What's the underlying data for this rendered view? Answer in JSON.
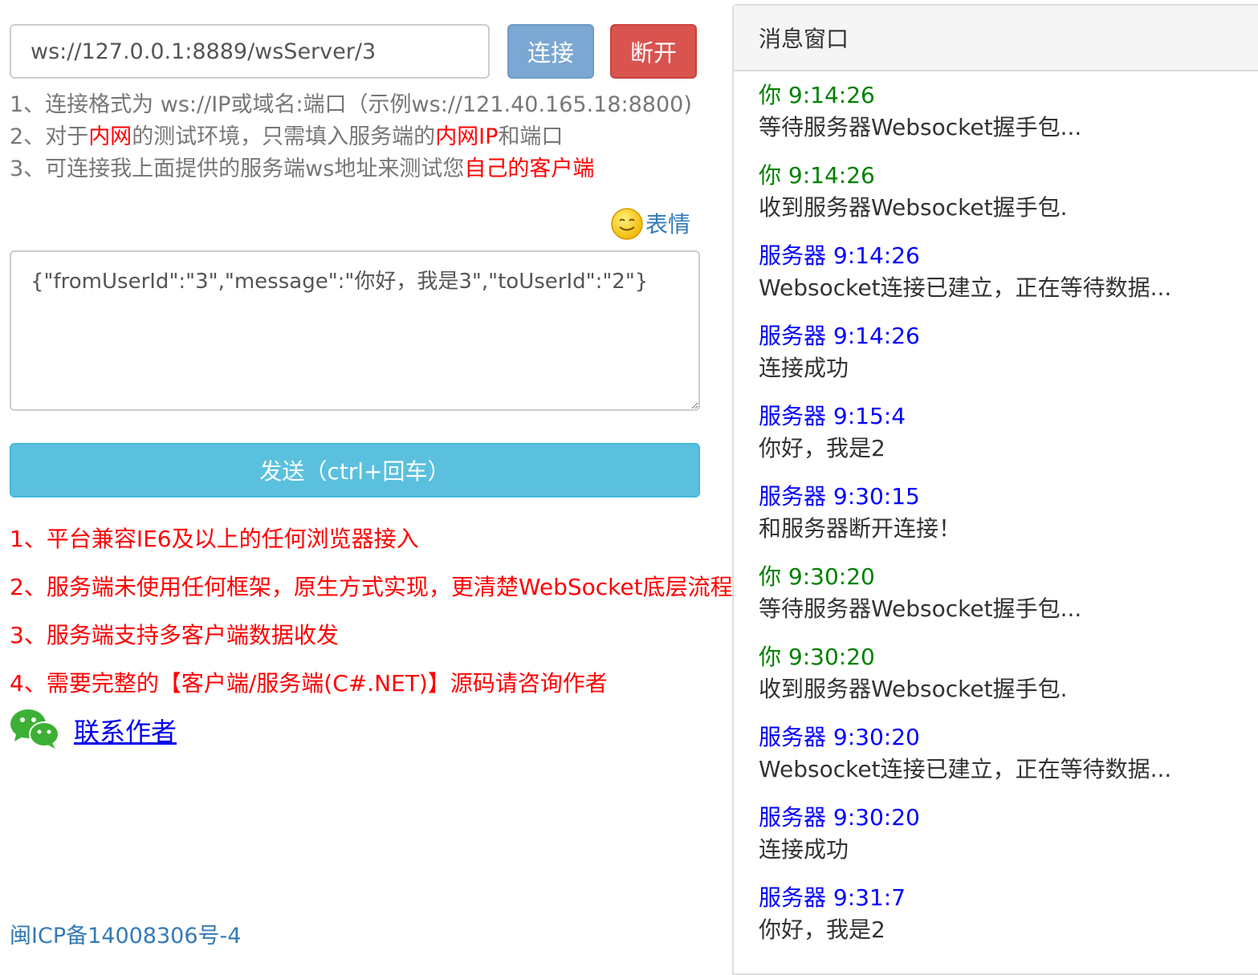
{
  "connection": {
    "url_value": "ws://127.0.0.1:8889/wsServer/3",
    "connect_label": "连接",
    "disconnect_label": "断开"
  },
  "hints": [
    {
      "parts": [
        {
          "t": "1、连接格式为 ws://IP或域名:端口（示例ws://121.40.165.18:8800)",
          "red": false
        }
      ]
    },
    {
      "parts": [
        {
          "t": "2、对于",
          "red": false
        },
        {
          "t": "内网",
          "red": true
        },
        {
          "t": "的测试环境，只需填入服务端的",
          "red": false
        },
        {
          "t": "内网IP",
          "red": true
        },
        {
          "t": "和端口",
          "red": false
        }
      ]
    },
    {
      "parts": [
        {
          "t": "3、可连接我上面提供的服务端ws地址来测试您",
          "red": false
        },
        {
          "t": "自己的客户端",
          "red": true
        }
      ]
    }
  ],
  "emoji": {
    "label": "表情",
    "icon": "smiley-face-icon"
  },
  "message_input": {
    "value": "{\"fromUserId\":\"3\",\"message\":\"你好，我是3\",\"toUserId\":\"2\"}"
  },
  "send_label": "发送（ctrl+回车）",
  "features": [
    "1、平台兼容IE6及以上的任何浏览器接入",
    "2、服务端未使用任何框架，原生方式实现，更清楚WebSocket底层流程",
    "3、服务端支持多客户端数据收发",
    "4、需要完整的【客户端/服务端(C#.NET)】源码请咨询作者"
  ],
  "contact": {
    "label": "联系作者",
    "icon": "wechat-icon"
  },
  "icp": "闽ICP备14008306号-4",
  "panel": {
    "title": "消息窗口",
    "messages": [
      {
        "sender": "你",
        "time": "9:14:26",
        "type": "you",
        "text": "等待服务器Websocket握手包..."
      },
      {
        "sender": "你",
        "time": "9:14:26",
        "type": "you",
        "text": "收到服务器Websocket握手包."
      },
      {
        "sender": "服务器",
        "time": "9:14:26",
        "type": "server",
        "text": "Websocket连接已建立，正在等待数据..."
      },
      {
        "sender": "服务器",
        "time": "9:14:26",
        "type": "server",
        "text": "连接成功"
      },
      {
        "sender": "服务器",
        "time": "9:15:4",
        "type": "server",
        "text": "你好，我是2"
      },
      {
        "sender": "服务器",
        "time": "9:30:15",
        "type": "server",
        "text": "和服务器断开连接！"
      },
      {
        "sender": "你",
        "time": "9:30:20",
        "type": "you",
        "text": "等待服务器Websocket握手包..."
      },
      {
        "sender": "你",
        "time": "9:30:20",
        "type": "you",
        "text": "收到服务器Websocket握手包."
      },
      {
        "sender": "服务器",
        "time": "9:30:20",
        "type": "server",
        "text": "Websocket连接已建立，正在等待数据..."
      },
      {
        "sender": "服务器",
        "time": "9:30:20",
        "type": "server",
        "text": "连接成功"
      },
      {
        "sender": "服务器",
        "time": "9:31:7",
        "type": "server",
        "text": "你好，我是2"
      }
    ]
  },
  "colors": {
    "you": "#008000",
    "server": "#0000ff",
    "red_text": "#ff0000",
    "send_button": "#5bc0de",
    "connect_button": "#7ba7d2",
    "disconnect_button": "#d9534f"
  }
}
